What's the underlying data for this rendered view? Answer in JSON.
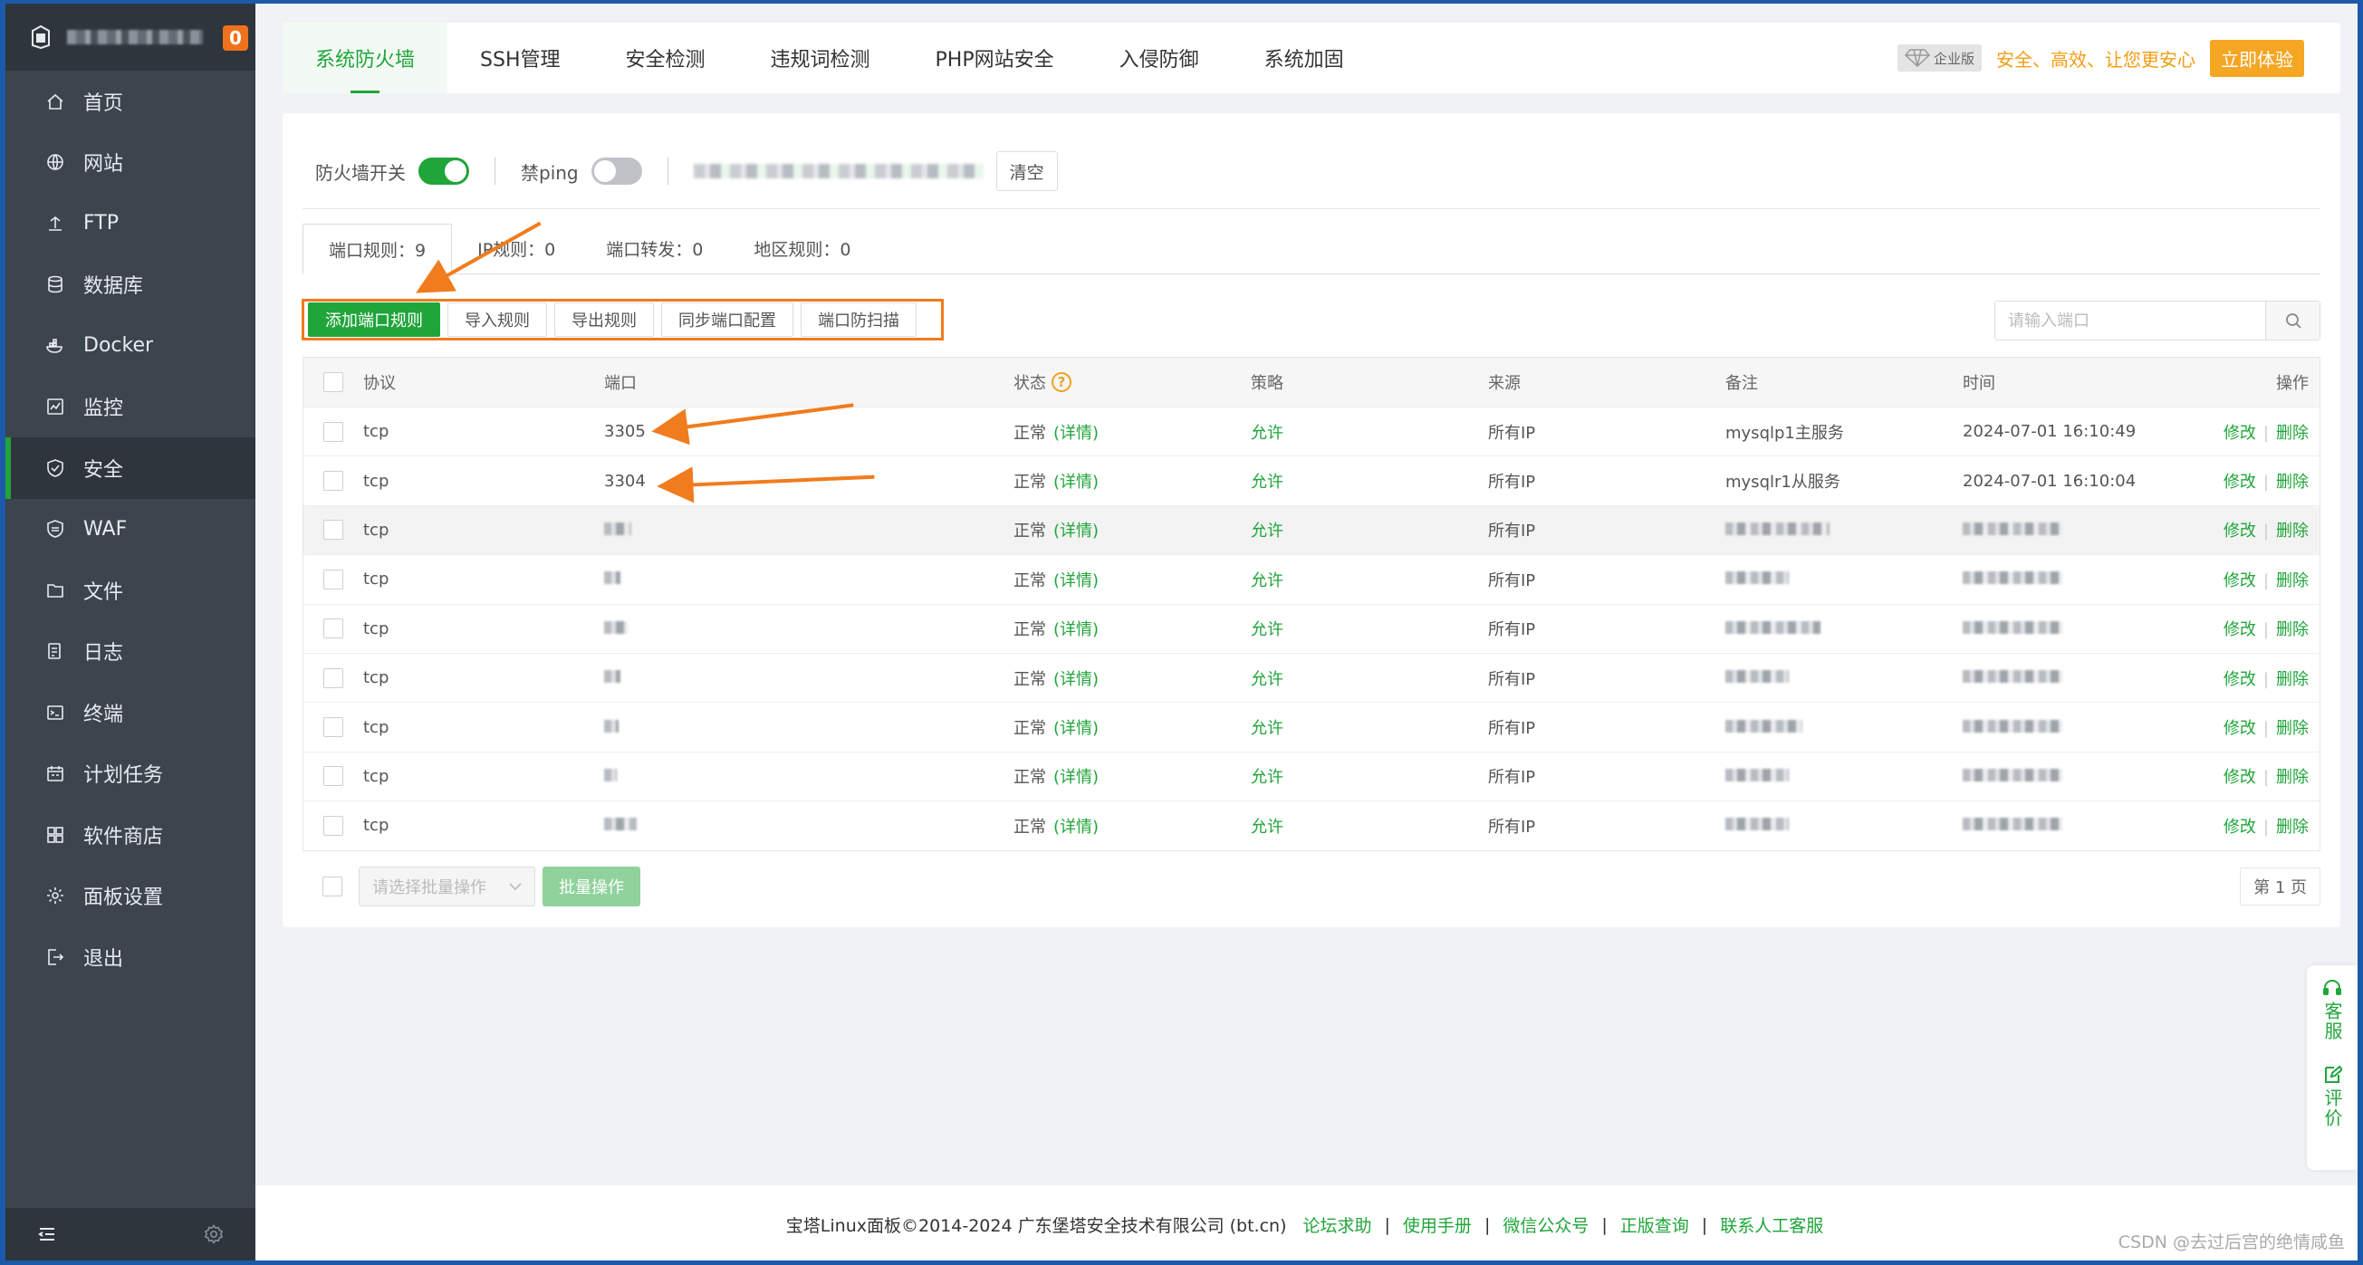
{
  "sidebar": {
    "badge": "0",
    "items": [
      {
        "label": "首页",
        "icon": "home-icon"
      },
      {
        "label": "网站",
        "icon": "globe-icon"
      },
      {
        "label": "FTP",
        "icon": "ftp-icon"
      },
      {
        "label": "数据库",
        "icon": "database-icon"
      },
      {
        "label": "Docker",
        "icon": "docker-icon"
      },
      {
        "label": "监控",
        "icon": "monitor-icon"
      },
      {
        "label": "安全",
        "icon": "shield-icon",
        "active": true
      },
      {
        "label": "WAF",
        "icon": "waf-icon"
      },
      {
        "label": "文件",
        "icon": "folder-icon"
      },
      {
        "label": "日志",
        "icon": "log-icon"
      },
      {
        "label": "终端",
        "icon": "terminal-icon"
      },
      {
        "label": "计划任务",
        "icon": "calendar-icon"
      },
      {
        "label": "软件商店",
        "icon": "grid-icon"
      },
      {
        "label": "面板设置",
        "icon": "gear-icon"
      },
      {
        "label": "退出",
        "icon": "logout-icon"
      }
    ]
  },
  "topbar": {
    "tabs": [
      "系统防火墙",
      "SSH管理",
      "安全检测",
      "违规词检测",
      "PHP网站安全",
      "入侵防御",
      "系统加固"
    ],
    "active_tab": 0,
    "enterprise_label": "企业版",
    "promo_text": "安全、高效、让您更安心",
    "promo_button": "立即体验"
  },
  "controls": {
    "firewall_switch_label": "防火墙开关",
    "firewall_on": true,
    "ping_label": "禁ping",
    "ping_on": false,
    "clear_button": "清空"
  },
  "subtabs": [
    {
      "label": "端口规则：9"
    },
    {
      "label": "IP规则：0"
    },
    {
      "label": "端口转发：0"
    },
    {
      "label": "地区规则：0"
    }
  ],
  "actions": {
    "add": "添加端口规则",
    "import": "导入规则",
    "export": "导出规则",
    "sync": "同步端口配置",
    "scan": "端口防扫描"
  },
  "search": {
    "placeholder": "请输入端口"
  },
  "table": {
    "headers": {
      "protocol": "协议",
      "port": "端口",
      "status": "状态",
      "policy": "策略",
      "source": "来源",
      "note": "备注",
      "time": "时间",
      "ops": "操作"
    },
    "rows": [
      {
        "protocol": "tcp",
        "port": "3305",
        "status": "正常",
        "detail": "(详情)",
        "policy": "允许",
        "source": "所有IP",
        "note": "mysqlp1主服务",
        "time": "2024-07-01 16:10:49"
      },
      {
        "protocol": "tcp",
        "port": "3304",
        "status": "正常",
        "detail": "(详情)",
        "policy": "允许",
        "source": "所有IP",
        "note": "mysqlr1从服务",
        "time": "2024-07-01 16:10:04"
      },
      {
        "protocol": "tcp",
        "port": "",
        "status": "正常",
        "detail": "(详情)",
        "policy": "允许",
        "source": "所有IP",
        "note": "",
        "time": ""
      },
      {
        "protocol": "tcp",
        "port": "",
        "status": "正常",
        "detail": "(详情)",
        "policy": "允许",
        "source": "所有IP",
        "note": "",
        "time": ""
      },
      {
        "protocol": "tcp",
        "port": "",
        "status": "正常",
        "detail": "(详情)",
        "policy": "允许",
        "source": "所有IP",
        "note": "",
        "time": ""
      },
      {
        "protocol": "tcp",
        "port": "",
        "status": "正常",
        "detail": "(详情)",
        "policy": "允许",
        "source": "所有IP",
        "note": "",
        "time": ""
      },
      {
        "protocol": "tcp",
        "port": "",
        "status": "正常",
        "detail": "(详情)",
        "policy": "允许",
        "source": "所有IP",
        "note": "",
        "time": ""
      },
      {
        "protocol": "tcp",
        "port": "",
        "status": "正常",
        "detail": "(详情)",
        "policy": "允许",
        "source": "所有IP",
        "note": "",
        "time": ""
      },
      {
        "protocol": "tcp",
        "port": "",
        "status": "正常",
        "detail": "(详情)",
        "policy": "允许",
        "source": "所有IP",
        "note": "",
        "time": ""
      }
    ],
    "op_edit": "修改",
    "op_delete": "删除"
  },
  "batch": {
    "placeholder": "请选择批量操作",
    "button": "批量操作"
  },
  "pager": {
    "label": "第 1 页"
  },
  "footer": {
    "copyright": "宝塔Linux面板©2014-2024 广东堡塔安全技术有限公司 (bt.cn)",
    "links": [
      "论坛求助",
      "使用手册",
      "微信公众号",
      "正版查询",
      "联系人工客服"
    ]
  },
  "float_side": {
    "service": "客服",
    "review": "评价"
  },
  "watermark": "CSDN @去过后宫的绝情咸鱼",
  "colors": {
    "accent": "#20a53a",
    "sidebar": "#3c444d",
    "annotation": "#f07c1e",
    "promo": "#f39c12"
  }
}
